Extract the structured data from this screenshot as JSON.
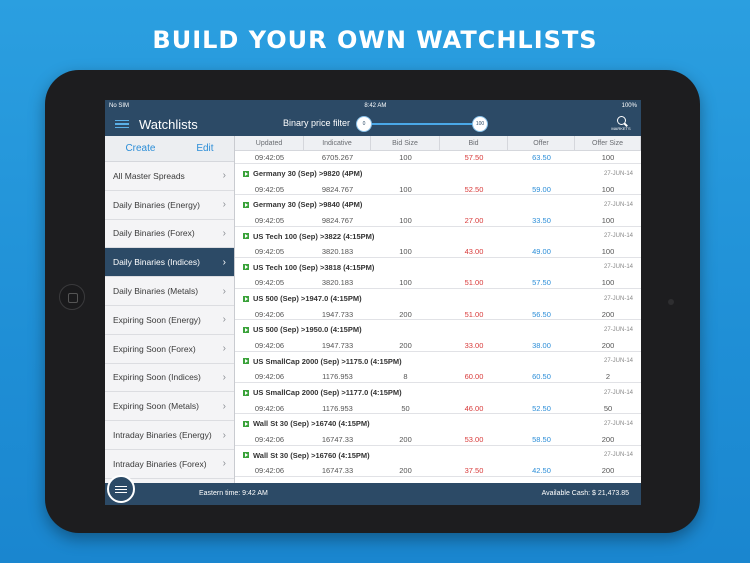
{
  "headline": "BUILD YOUR OWN WATCHLISTS",
  "status": {
    "carrier": "No SIM",
    "time": "8:42 AM",
    "battery": "100%"
  },
  "nav": {
    "title": "Watchlists",
    "filter_label": "Binary price filter",
    "slider_min": "0",
    "slider_max": "100",
    "markets_label": "MARKETS"
  },
  "sidebar": {
    "create": "Create",
    "edit": "Edit",
    "items": [
      "All Master Spreads",
      "Daily Binaries (Energy)",
      "Daily Binaries (Forex)",
      "Daily Binaries (Indices)",
      "Daily Binaries (Metals)",
      "Expiring Soon (Energy)",
      "Expiring Soon (Forex)",
      "Expiring Soon (Indices)",
      "Expiring Soon (Metals)",
      "Intraday Binaries (Energy)",
      "Intraday Binaries (Forex)"
    ],
    "active_index": 3
  },
  "table": {
    "headers": [
      "Updated",
      "Indicative",
      "Bid Size",
      "Bid",
      "Offer",
      "Offer Size"
    ],
    "first_row": {
      "updated": "09:42:05",
      "indicative": "6705.267",
      "bid_size": "100",
      "bid": "57.50",
      "offer": "63.50",
      "offer_size": "100"
    },
    "rows": [
      {
        "name": "Germany 30 (Sep) >9820 (4PM)",
        "date": "27-JUN-14",
        "updated": "09:42:05",
        "indicative": "9824.767",
        "bid_size": "100",
        "bid": "52.50",
        "offer": "59.00",
        "offer_size": "100"
      },
      {
        "name": "Germany 30 (Sep) >9840 (4PM)",
        "date": "27-JUN-14",
        "updated": "09:42:05",
        "indicative": "9824.767",
        "bid_size": "100",
        "bid": "27.00",
        "offer": "33.50",
        "offer_size": "100"
      },
      {
        "name": "US Tech 100 (Sep) >3822 (4:15PM)",
        "date": "27-JUN-14",
        "updated": "09:42:05",
        "indicative": "3820.183",
        "bid_size": "100",
        "bid": "43.00",
        "offer": "49.00",
        "offer_size": "100"
      },
      {
        "name": "US Tech 100 (Sep) >3818 (4:15PM)",
        "date": "27-JUN-14",
        "updated": "09:42:05",
        "indicative": "3820.183",
        "bid_size": "100",
        "bid": "51.00",
        "offer": "57.50",
        "offer_size": "100"
      },
      {
        "name": "US 500 (Sep) >1947.0 (4:15PM)",
        "date": "27-JUN-14",
        "updated": "09:42:06",
        "indicative": "1947.733",
        "bid_size": "200",
        "bid": "51.00",
        "offer": "56.50",
        "offer_size": "200"
      },
      {
        "name": "US 500 (Sep) >1950.0 (4:15PM)",
        "date": "27-JUN-14",
        "updated": "09:42:06",
        "indicative": "1947.733",
        "bid_size": "200",
        "bid": "33.00",
        "offer": "38.00",
        "offer_size": "200"
      },
      {
        "name": "US SmallCap 2000 (Sep) >1175.0 (4:15PM)",
        "date": "27-JUN-14",
        "updated": "09:42:06",
        "indicative": "1176.953",
        "bid_size": "8",
        "bid": "60.00",
        "offer": "60.50",
        "offer_size": "2"
      },
      {
        "name": "US SmallCap 2000 (Sep) >1177.0 (4:15PM)",
        "date": "27-JUN-14",
        "updated": "09:42:06",
        "indicative": "1176.953",
        "bid_size": "50",
        "bid": "46.00",
        "offer": "52.50",
        "offer_size": "50"
      },
      {
        "name": "Wall St 30 (Sep) >16740 (4:15PM)",
        "date": "27-JUN-14",
        "updated": "09:42:06",
        "indicative": "16747.33",
        "bid_size": "200",
        "bid": "53.00",
        "offer": "58.50",
        "offer_size": "200"
      },
      {
        "name": "Wall St 30 (Sep) >16760 (4:15PM)",
        "date": "27-JUN-14",
        "updated": "09:42:06",
        "indicative": "16747.33",
        "bid_size": "200",
        "bid": "37.50",
        "offer": "42.50",
        "offer_size": "200"
      }
    ]
  },
  "footer": {
    "eastern": "Eastern time: 9:42 AM",
    "cash": "Available Cash: $ 21,473.85"
  },
  "colors": {
    "navy": "#2c4a66",
    "accent": "#2c8ed8",
    "bid": "#d83a3a",
    "up_flag": "#3aa23a"
  }
}
